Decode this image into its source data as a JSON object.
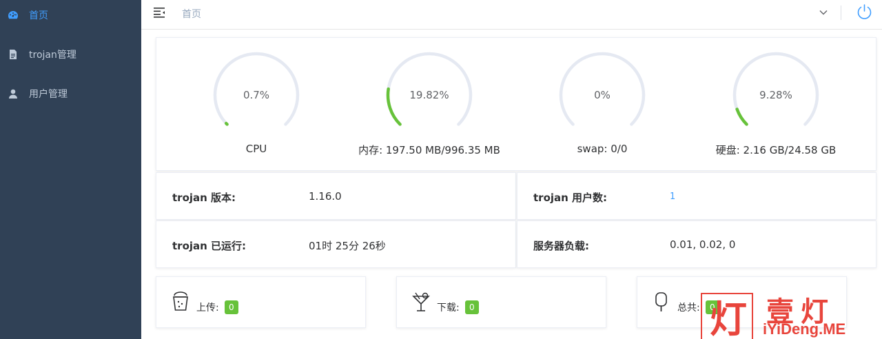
{
  "sidebar": {
    "items": [
      {
        "label": "首页",
        "icon": "dashboard-icon",
        "active": true
      },
      {
        "label": "trojan管理",
        "icon": "document-icon",
        "active": false
      },
      {
        "label": "用户管理",
        "icon": "user-icon",
        "active": false
      }
    ]
  },
  "header": {
    "breadcrumb": "首页"
  },
  "gauges": [
    {
      "value": 0.7,
      "percent_text": "0.7%",
      "caption": "CPU"
    },
    {
      "value": 19.82,
      "percent_text": "19.82%",
      "caption": "内存: 197.50 MB/996.35 MB"
    },
    {
      "value": 0,
      "percent_text": "0%",
      "caption": "swap: 0/0"
    },
    {
      "value": 9.28,
      "percent_text": "9.28%",
      "caption": "硬盘: 2.16 GB/24.58 GB"
    }
  ],
  "info": {
    "version_label": "trojan 版本:",
    "version_value": "1.16.0",
    "users_label": "trojan 用户数:",
    "users_value": "1",
    "uptime_label": "trojan 已运行:",
    "uptime_value": "01时 25分 26秒",
    "load_label": "服务器负载:",
    "load_value": "0.01, 0.02, 0"
  },
  "traffic": {
    "upload_label": "上传:",
    "upload_value": "0",
    "download_label": "下载:",
    "download_value": "0",
    "total_label": "总共:",
    "total_value": "0"
  },
  "watermark": {
    "box_char": "灯",
    "main": "壹灯",
    "sub": "iYiDeng.ME"
  },
  "colors": {
    "sidebar_bg": "#304156",
    "active": "#409eff",
    "gauge_track": "#e5e9f2",
    "gauge_fill": "#67c23a",
    "tag": "#67c23a",
    "watermark": "#e8453c"
  }
}
